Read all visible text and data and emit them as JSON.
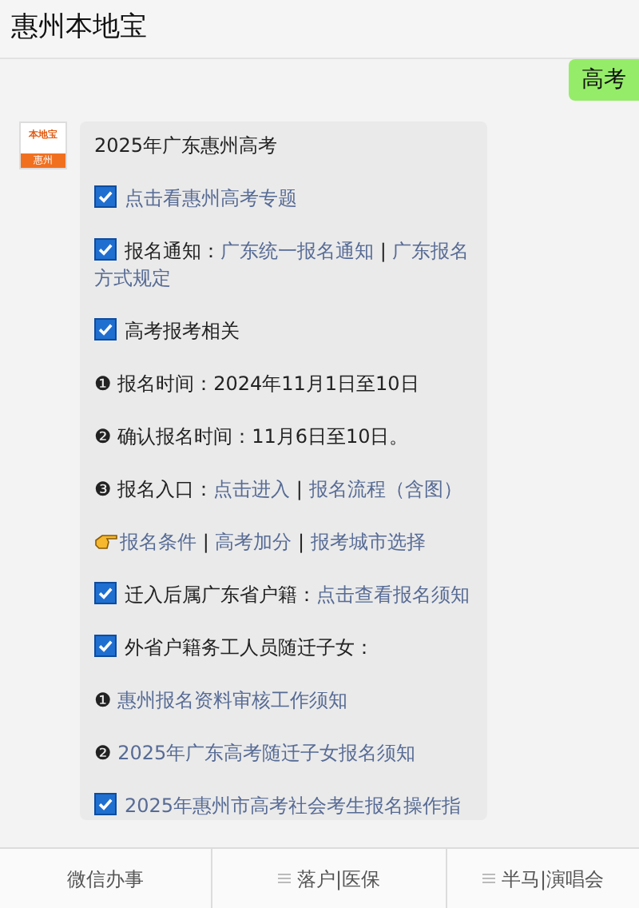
{
  "header": {
    "title": "惠州本地宝"
  },
  "messages": [
    {
      "kind": "sent",
      "text": "高考"
    },
    {
      "kind": "received",
      "avatar": {
        "top": "本地宝",
        "bottom": "惠州"
      },
      "paragraphs": [
        {
          "kind": "plain",
          "segments": [
            {
              "kind": "text",
              "text": "2025年广东惠州高考"
            }
          ]
        },
        {
          "kind": "check",
          "segments": [
            {
              "kind": "link",
              "text": "点击看惠州高考专题"
            }
          ]
        },
        {
          "kind": "check",
          "segments": [
            {
              "kind": "text",
              "text": "报名通知："
            },
            {
              "kind": "link",
              "text": "广东统一报名通知"
            },
            {
              "kind": "text",
              "text": " | "
            },
            {
              "kind": "link",
              "text": "广东报名"
            },
            {
              "kind": "link",
              "text": "方式规定"
            }
          ]
        },
        {
          "kind": "check",
          "segments": [
            {
              "kind": "text",
              "text": "高考报考相关"
            }
          ]
        },
        {
          "kind": "plain",
          "segments": [
            {
              "kind": "text",
              "text": "❶ 报名时间：2024年11月1日至10日"
            }
          ]
        },
        {
          "kind": "plain",
          "segments": [
            {
              "kind": "text",
              "text": "❷ 确认报名时间：11月6日至10日。"
            }
          ]
        },
        {
          "kind": "plain",
          "segments": [
            {
              "kind": "text",
              "text": "❸ 报名入口："
            },
            {
              "kind": "link",
              "text": "点击进入"
            },
            {
              "kind": "text",
              "text": " | "
            },
            {
              "kind": "link",
              "text": "报名流程（含图）"
            }
          ]
        },
        {
          "kind": "hand",
          "segments": [
            {
              "kind": "link",
              "text": "报名条件"
            },
            {
              "kind": "text",
              "text": " | "
            },
            {
              "kind": "link",
              "text": "高考加分"
            },
            {
              "kind": "text",
              "text": " | "
            },
            {
              "kind": "link",
              "text": "报考城市选择"
            }
          ]
        },
        {
          "kind": "check",
          "segments": [
            {
              "kind": "text",
              "text": "迁入后属广东省户籍："
            },
            {
              "kind": "link",
              "text": "点击查看报名须"
            },
            {
              "kind": "link",
              "text": "知"
            }
          ]
        },
        {
          "kind": "check",
          "segments": [
            {
              "kind": "text",
              "text": "外省户籍务工人员随迁子女："
            }
          ]
        },
        {
          "kind": "plain",
          "segments": [
            {
              "kind": "text",
              "text": "❶ "
            },
            {
              "kind": "link",
              "text": "惠州报名资料审核工作须知"
            }
          ]
        },
        {
          "kind": "plain",
          "segments": [
            {
              "kind": "text",
              "text": "❷ "
            },
            {
              "kind": "link",
              "text": "2025年广东高考随迁子女报名须知"
            }
          ]
        },
        {
          "kind": "check",
          "segments": [
            {
              "kind": "link",
              "text": "2025年惠州市高考社会考生报名操作指"
            }
          ]
        }
      ]
    }
  ],
  "bottom_menu": [
    {
      "label": "微信办事",
      "menu": false
    },
    {
      "label": "落户|医保",
      "menu": true
    },
    {
      "label": "半马|演唱会",
      "menu": true
    }
  ]
}
